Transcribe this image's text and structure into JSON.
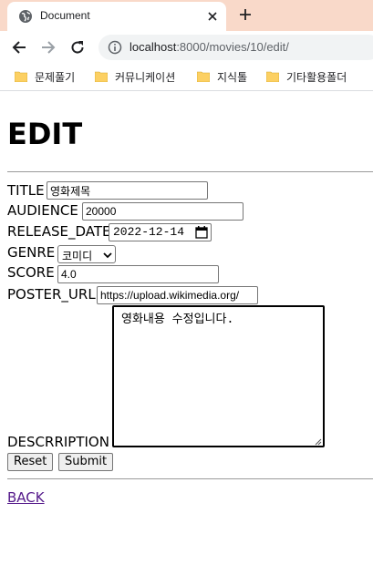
{
  "browser": {
    "tab_title": "Document",
    "url_host": "localhost",
    "url_path": ":8000/movies/10/edit/",
    "bookmarks": [
      "문제풀기",
      "커뮤니케이션",
      "지식톨",
      "기타활용폴더"
    ]
  },
  "page": {
    "heading": "EDIT",
    "form": {
      "title_label": "TITLE",
      "title_value": "영화제목",
      "audience_label": "AUDIENCE",
      "audience_value": "20000",
      "release_date_label": "RELEASE_DATE",
      "release_date_value": "2022-12-14",
      "genre_label": "GENRE",
      "genre_value": "코미디",
      "score_label": "SCORE",
      "score_value": "4.0",
      "poster_url_label": "POSTER_URL",
      "poster_url_value": "https://upload.wikimedia.org/",
      "description_label": "DESCRRIPTION",
      "description_value": "영화내용 수정입니다.",
      "reset_label": "Reset",
      "submit_label": "Submit"
    },
    "back_link": "BACK"
  }
}
